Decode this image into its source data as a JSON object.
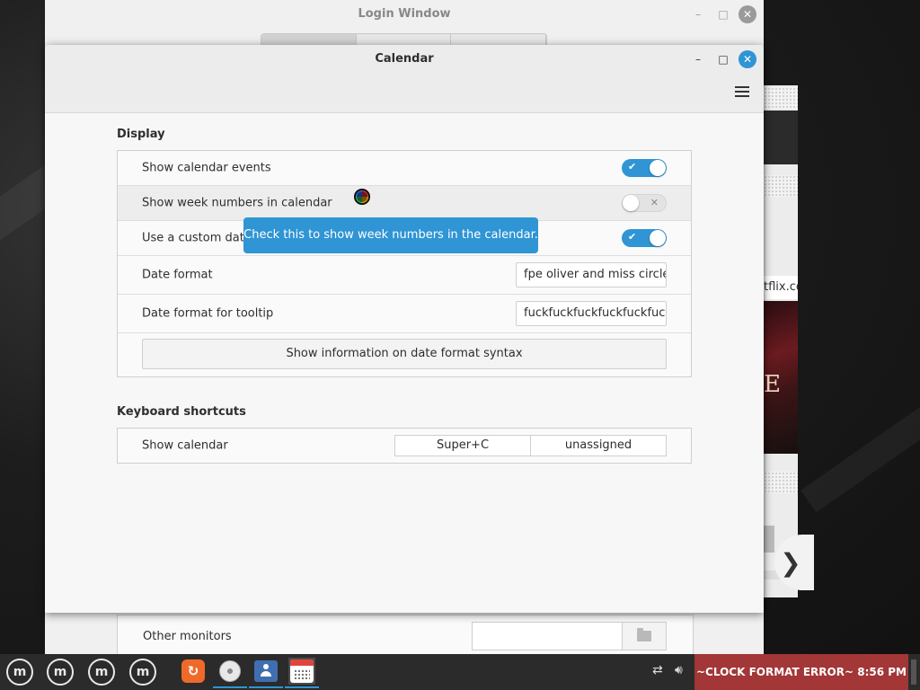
{
  "login_window": {
    "title": "Login Window",
    "other_monitors_label": "Other monitors"
  },
  "calendar_window": {
    "title": "Calendar",
    "display": {
      "section_title": "Display",
      "show_events_label": "Show calendar events",
      "show_events_on": true,
      "week_numbers_label": "Show week numbers in calendar",
      "week_numbers_on": false,
      "custom_date_label": "Use a custom date",
      "custom_date_on": true,
      "date_format_label": "Date format",
      "date_format_value": "fpe oliver and miss circle v",
      "tooltip_format_label": "Date format for tooltip",
      "tooltip_format_value": "fuckfuckfuckfuckfuckfuc",
      "syntax_button": "Show information on date format syntax"
    },
    "shortcuts": {
      "section_title": "Keyboard shortcuts",
      "show_calendar_label": "Show calendar",
      "accel_primary": "Super+C",
      "accel_secondary": "unassigned"
    },
    "tooltip": "Check this to show week numbers in the calendar."
  },
  "background_window": {
    "url_fragment": "tflix.co",
    "poster_letter": "E"
  },
  "taskbar": {
    "menu_glyph": "m",
    "clock_text": "~CLOCK FORMAT ERROR~  8:56 PM"
  },
  "colors": {
    "accent": "#2f95d4",
    "clock_error_bg": "#a33636"
  }
}
